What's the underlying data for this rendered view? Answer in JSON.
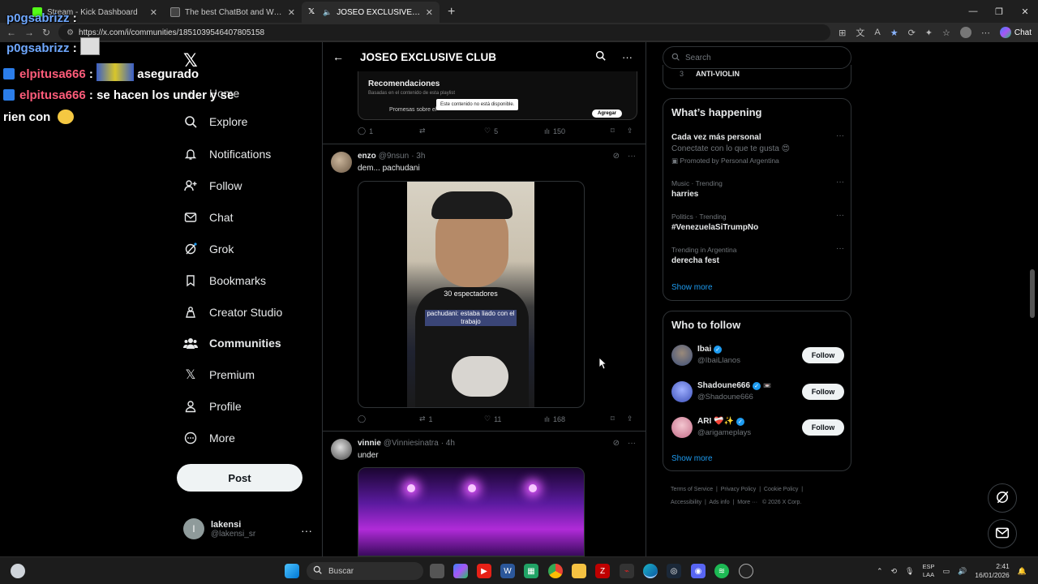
{
  "browser": {
    "tabs": [
      {
        "title": "Stream - Kick Dashboard",
        "color": "#53fc18",
        "active": false
      },
      {
        "title": "The best ChatBot and Widgets for",
        "color": "#1e1e1e",
        "active": false
      },
      {
        "title": "JOSEO EXCLUSIVE CLUB Comm",
        "color": "#000000",
        "active": true
      }
    ],
    "url": "https://x.com/i/communities/1851039546407805158",
    "chat_label": "Chat"
  },
  "overlay": {
    "lines": [
      {
        "user": "p0gsabrizz",
        "sep": " :",
        "msg": ""
      },
      {
        "user": "p0gsabrizz",
        "sep": " :",
        "msg": ""
      },
      {
        "user": "elpitusa666",
        "sep": " :",
        "msg": "asegurado"
      },
      {
        "user": "elpitusa666",
        "sep": " :",
        "msg": "se hacen los under y se"
      },
      {
        "user": "",
        "sep": "",
        "msg": "rien con"
      }
    ]
  },
  "nav": {
    "items": [
      {
        "label": "Home",
        "icon": "home-icon"
      },
      {
        "label": "Explore",
        "icon": "search-icon"
      },
      {
        "label": "Notifications",
        "icon": "bell-icon"
      },
      {
        "label": "Follow",
        "icon": "add-person-icon"
      },
      {
        "label": "Chat",
        "icon": "mail-icon"
      },
      {
        "label": "Grok",
        "icon": "grok-icon"
      },
      {
        "label": "Bookmarks",
        "icon": "bookmark-icon"
      },
      {
        "label": "Creator Studio",
        "icon": "creator-icon"
      },
      {
        "label": "Communities",
        "icon": "communities-icon"
      },
      {
        "label": "Premium",
        "icon": "x-icon"
      },
      {
        "label": "Profile",
        "icon": "person-icon"
      },
      {
        "label": "More",
        "icon": "more-circle-icon"
      }
    ],
    "post_label": "Post",
    "account": {
      "initial": "l",
      "name": "lakensi",
      "handle": "@lakensi_sr"
    }
  },
  "main": {
    "title": "JOSEO EXCLUSIVE CLUB",
    "embed": {
      "title": "Recomendaciones",
      "subtitle": "Basadas en el contenido de esta playlist",
      "item": "Promesas sobre el",
      "tooltip": "Este contenido no está disponible.",
      "add": "Agregar"
    },
    "post0": {
      "replies": "1",
      "likes": "5",
      "views": "150"
    },
    "post1": {
      "name": "enzo",
      "handle": "@9nsun",
      "time": "· 3h",
      "text": "dem... pachudani",
      "overlay1": "30 espectadores",
      "overlay2": "pachudani: estaba liado con el trabajo",
      "replies": "",
      "reposts": "1",
      "likes": "11",
      "views": "168"
    },
    "post2": {
      "name": "vinnie",
      "handle": "@Vinniesinatra",
      "time": "· 4h",
      "text": "under"
    }
  },
  "right": {
    "search_placeholder": "Search",
    "rule": {
      "num": "3",
      "text": "ANTI-VIOLIN"
    },
    "happening": {
      "title": "What’s happening",
      "trends": [
        {
          "meta": "",
          "name": "Cada vez más personal",
          "sub": "Conectate con lo que te gusta 😍",
          "promo": "Promoted by Personal Argentina"
        },
        {
          "meta": "Music · Trending",
          "name": "harries",
          "sub": "",
          "promo": ""
        },
        {
          "meta": "Politics · Trending",
          "name": "#VenezuelaSiTrumpNo",
          "sub": "",
          "promo": ""
        },
        {
          "meta": "Trending in Argentina",
          "name": "derecha fest",
          "sub": "",
          "promo": ""
        }
      ],
      "show_more": "Show more"
    },
    "who": {
      "title": "Who to follow",
      "people": [
        {
          "name": "Ibai",
          "handle": "@IbaiLlanos",
          "extra": "",
          "color": "#4a5a8a"
        },
        {
          "name": "Shadoune666",
          "handle": "@Shadoune666",
          "extra": "📼",
          "color": "#3b4fb8"
        },
        {
          "name": "ARI ❤️‍🩹✨",
          "handle": "@arigameplays",
          "extra": "",
          "color": "#d88aa0"
        }
      ],
      "follow_label": "Follow",
      "show_more": "Show more"
    },
    "footer": [
      "Terms of Service",
      "Privacy Policy",
      "Cookie Policy",
      "Accessibility",
      "Ads info",
      "More ···",
      "© 2026 X Corp."
    ]
  },
  "taskbar": {
    "search": "Buscar",
    "lang1": "ESP",
    "lang2": "LAA",
    "time": "2:41",
    "date": "16/01/2026"
  }
}
